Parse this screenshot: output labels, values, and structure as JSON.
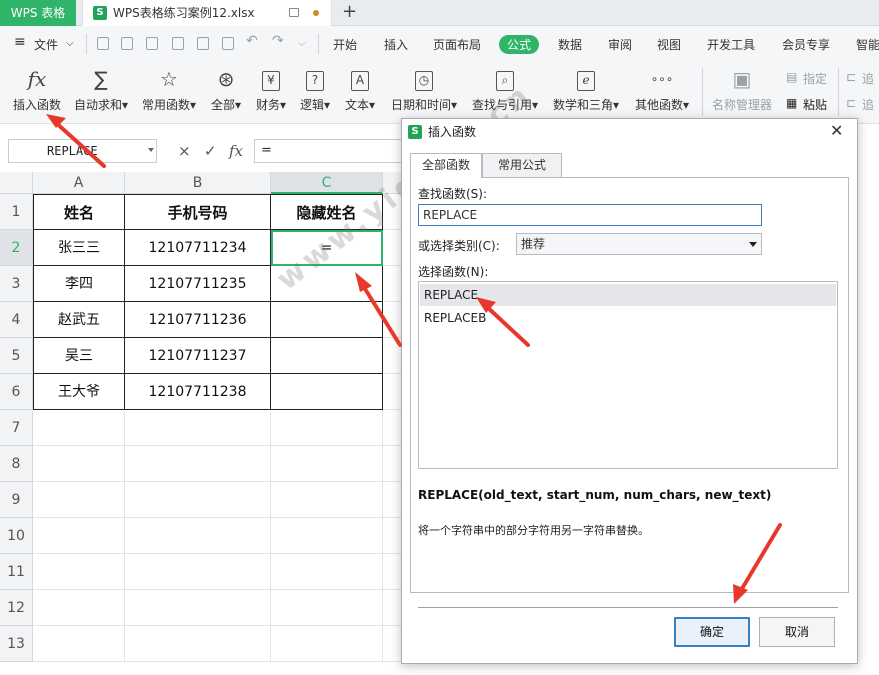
{
  "app": {
    "name": "WPS 表格"
  },
  "tabs": [
    {
      "label": "WPS表格练习案例12.xlsx"
    }
  ],
  "quick": {
    "file_label": "文件"
  },
  "menu": [
    "开始",
    "插入",
    "页面布局",
    "公式",
    "数据",
    "审阅",
    "视图",
    "开发工具",
    "会员专享",
    "智能"
  ],
  "menu_active": "公式",
  "ribbon": {
    "buttons": [
      {
        "icon": "fx-icon",
        "glyph": "fx",
        "label": "插入函数"
      },
      {
        "icon": "sigma-icon",
        "glyph": "∑",
        "label": "自动求和▾"
      },
      {
        "icon": "star-icon",
        "glyph": "☆",
        "label": "常用函数▾"
      },
      {
        "icon": "asterisk-icon",
        "glyph": "⊛",
        "label": "全部▾"
      },
      {
        "icon": "yen-icon",
        "glyph": "¥",
        "label": "财务▾"
      },
      {
        "icon": "question-icon",
        "glyph": "?",
        "label": "逻辑▾"
      },
      {
        "icon": "text-a-icon",
        "glyph": "A",
        "label": "文本▾"
      },
      {
        "icon": "clock-icon",
        "glyph": "◷",
        "label": "日期和时间▾"
      },
      {
        "icon": "lookup-icon",
        "glyph": "⌕",
        "label": "查找与引用▾"
      },
      {
        "icon": "math-e-icon",
        "glyph": "e",
        "label": "数学和三角▾"
      },
      {
        "icon": "more-dots-icon",
        "glyph": "∘∘∘",
        "label": "其他函数▾"
      },
      {
        "icon": "name-manager-icon",
        "glyph": "▣",
        "label": "名称管理器"
      }
    ],
    "side_top": "指定",
    "side_bottom": "粘贴",
    "side_cut_top": "追",
    "side_cut_bottom": "追"
  },
  "formula_bar": {
    "name_box": "REPLACE",
    "cancel_glyph": "×",
    "confirm_glyph": "✓",
    "fx_glyph": "fx",
    "content": "="
  },
  "sheet": {
    "columns": [
      "A",
      "B",
      "C"
    ],
    "rows": [
      "1",
      "2",
      "3",
      "4",
      "5",
      "6",
      "7",
      "8",
      "9",
      "10",
      "11",
      "12",
      "13"
    ],
    "headers": [
      "姓名",
      "手机号码",
      "隐藏姓名"
    ],
    "data": [
      [
        "张三三",
        "12107711234",
        "="
      ],
      [
        "李四",
        "12107711235",
        ""
      ],
      [
        "赵武五",
        "12107711236",
        ""
      ],
      [
        "吴三",
        "12107711237",
        ""
      ],
      [
        "王大爷",
        "12107711238",
        ""
      ]
    ]
  },
  "dialog": {
    "title": "插入函数",
    "close_glyph": "✕",
    "tabs": [
      "全部函数",
      "常用公式"
    ],
    "search_label": "查找函数(S):",
    "search_value": "REPLACE",
    "category_label": "或选择类别(C):",
    "category_value": "推荐",
    "list_label": "选择函数(N):",
    "functions": [
      "REPLACE",
      "REPLACEB"
    ],
    "selected_function": "REPLACE",
    "syntax": "REPLACE(old_text, start_num, num_chars, new_text)",
    "description": "将一个字符串中的部分字符用另一字符串替换。",
    "ok_label": "确定",
    "cancel_label": "取消"
  },
  "watermark": "www.yigujin.cn",
  "colors": {
    "brand": "#2fb46a",
    "arrow": "#e8382c",
    "focus": "#3b82c4"
  }
}
